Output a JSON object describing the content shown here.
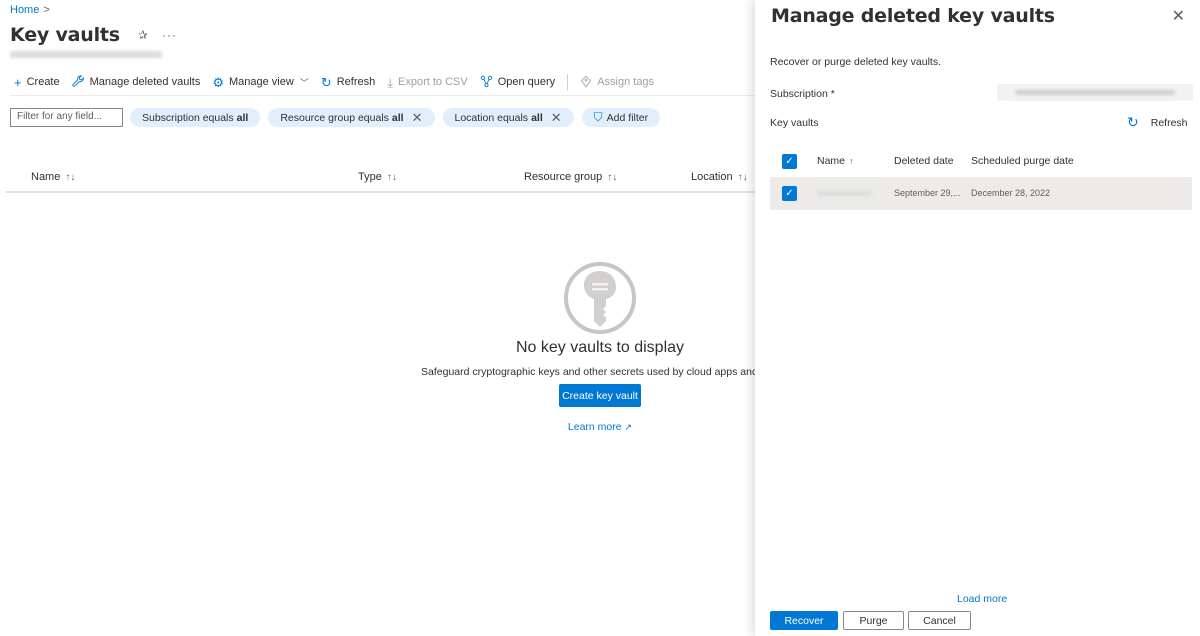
{
  "breadcrumb": {
    "home": "Home",
    "sep": ">"
  },
  "page": {
    "title": "Key vaults",
    "pin": "✰",
    "more": "···"
  },
  "toolbar": {
    "create": "Create",
    "manage_deleted": "Manage deleted vaults",
    "manage_view": "Manage view",
    "refresh": "Refresh",
    "export_csv": "Export to CSV",
    "open_query": "Open query",
    "assign_tags": "Assign tags"
  },
  "filters": {
    "placeholder": "Filter for any field...",
    "subscription_label": "Subscription equals",
    "subscription_value": "all",
    "resource_group_label": "Resource group equals",
    "resource_group_value": "all",
    "location_label": "Location equals",
    "location_value": "all",
    "add_filter": "Add filter"
  },
  "table": {
    "columns": [
      "Name",
      "Type",
      "Resource group",
      "Location"
    ],
    "sort_glyph": "↑↓"
  },
  "empty_state": {
    "title": "No key vaults to display",
    "description": "Safeguard cryptographic keys and other secrets used by cloud apps and ser",
    "create_button": "Create key vault",
    "learn_more": "Learn more"
  },
  "panel": {
    "title": "Manage deleted key vaults",
    "close": "✕",
    "description": "Recover or purge deleted key vaults.",
    "subscription_label": "Subscription *",
    "key_vaults_label": "Key vaults",
    "refresh": "Refresh",
    "grid_columns": {
      "name": "Name",
      "deleted": "Deleted date",
      "purge": "Scheduled purge date",
      "name_sort": "↑"
    },
    "rows": [
      {
        "deleted_date": "September 29,...",
        "purge_date": "December 28, 2022",
        "selected": true
      }
    ],
    "load_more": "Load more",
    "buttons": {
      "recover": "Recover",
      "purge": "Purge",
      "cancel": "Cancel"
    }
  },
  "colors": {
    "accent": "#0078d4",
    "pill_bg": "#e1eefb",
    "text": "#323130"
  },
  "icons": [
    "plus-icon",
    "wrench-icon",
    "gear-icon",
    "refresh-icon",
    "download-icon",
    "query-icon",
    "tag-icon",
    "add-filter-icon",
    "close-icon",
    "pin-icon",
    "key-icon",
    "external-link-icon",
    "checkmark-icon"
  ]
}
